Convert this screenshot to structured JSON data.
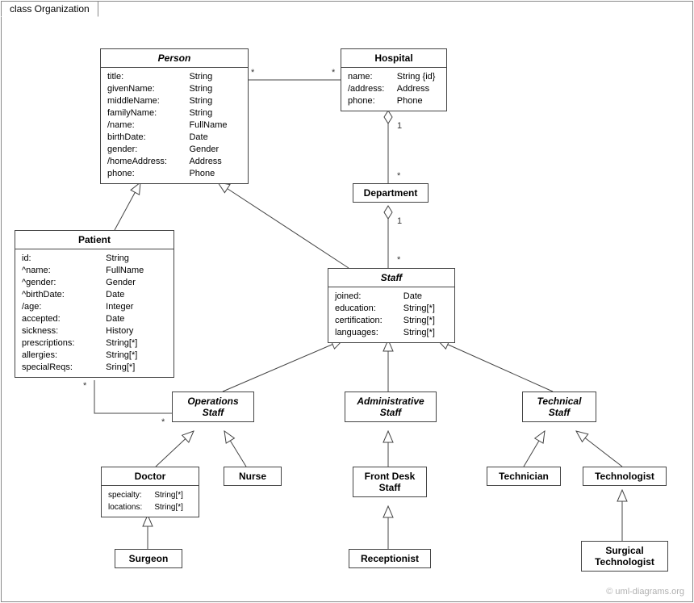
{
  "frame": {
    "title": "class Organization"
  },
  "watermark": "© uml-diagrams.org",
  "classes": {
    "person": {
      "name": "Person",
      "attrs": [
        [
          "title:",
          "String"
        ],
        [
          "givenName:",
          "String"
        ],
        [
          "middleName:",
          "String"
        ],
        [
          "familyName:",
          "String"
        ],
        [
          "/name:",
          "FullName"
        ],
        [
          "birthDate:",
          "Date"
        ],
        [
          "gender:",
          "Gender"
        ],
        [
          "/homeAddress:",
          "Address"
        ],
        [
          "phone:",
          "Phone"
        ]
      ]
    },
    "hospital": {
      "name": "Hospital",
      "attrs": [
        [
          "name:",
          "String {id}"
        ],
        [
          "/address:",
          "Address"
        ],
        [
          "phone:",
          "Phone"
        ]
      ]
    },
    "department": {
      "name": "Department"
    },
    "patient": {
      "name": "Patient",
      "attrs": [
        [
          "id:",
          "String"
        ],
        [
          "^name:",
          "FullName"
        ],
        [
          "^gender:",
          "Gender"
        ],
        [
          "^birthDate:",
          "Date"
        ],
        [
          "/age:",
          "Integer"
        ],
        [
          "accepted:",
          "Date"
        ],
        [
          "sickness:",
          "History"
        ],
        [
          "prescriptions:",
          "String[*]"
        ],
        [
          "allergies:",
          "String[*]"
        ],
        [
          "specialReqs:",
          "Sring[*]"
        ]
      ]
    },
    "staff": {
      "name": "Staff",
      "attrs": [
        [
          "joined:",
          "Date"
        ],
        [
          "education:",
          "String[*]"
        ],
        [
          "certification:",
          "String[*]"
        ],
        [
          "languages:",
          "String[*]"
        ]
      ]
    },
    "opsStaff": {
      "name": "Operations\nStaff"
    },
    "adminStaff": {
      "name": "Administrative\nStaff"
    },
    "techStaff": {
      "name": "Technical\nStaff"
    },
    "doctor": {
      "name": "Doctor",
      "attrs": [
        [
          "specialty:",
          "String[*]"
        ],
        [
          "locations:",
          "String[*]"
        ]
      ]
    },
    "nurse": {
      "name": "Nurse"
    },
    "frontDesk": {
      "name": "Front Desk\nStaff"
    },
    "technician": {
      "name": "Technician"
    },
    "technologist": {
      "name": "Technologist"
    },
    "surgeon": {
      "name": "Surgeon"
    },
    "receptionist": {
      "name": "Receptionist"
    },
    "surgTech": {
      "name": "Surgical\nTechnologist"
    }
  },
  "mult": {
    "personStar": "*",
    "hospitalStar": "*",
    "hospDept1": "1",
    "hospDeptStar": "*",
    "deptStaff1": "1",
    "deptStaffStar": "*",
    "patientOpsStarA": "*",
    "patientOpsStarB": "*"
  }
}
